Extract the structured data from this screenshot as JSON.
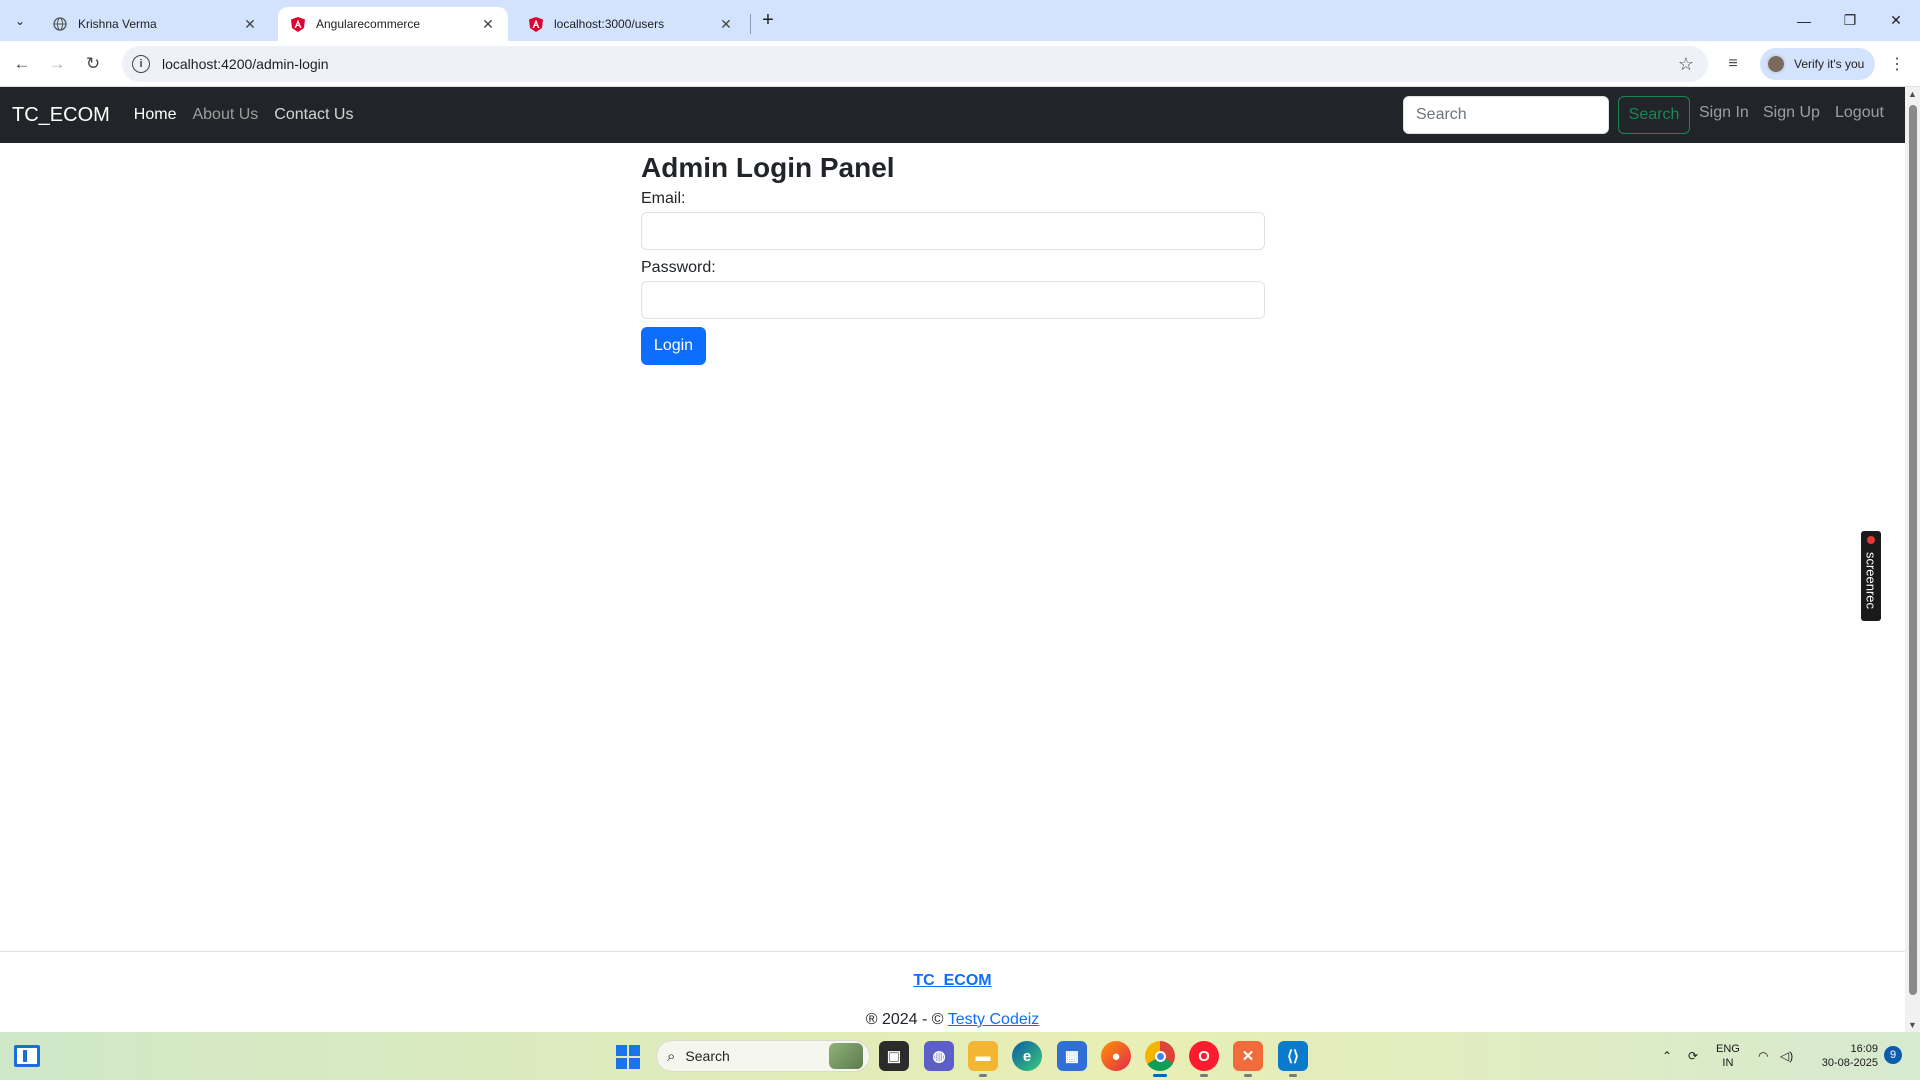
{
  "browser": {
    "tabs": [
      {
        "title": "Krishna Verma",
        "icon": "globe-icon"
      },
      {
        "title": "Angularecommerce",
        "icon": "angular-icon"
      },
      {
        "title": "localhost:3000/users",
        "icon": "angular-icon"
      }
    ],
    "url": "localhost:4200/admin-login",
    "profile_label": "Verify it's you"
  },
  "navbar": {
    "brand": "TC_ECOM",
    "links": [
      "Home",
      "About Us",
      "Contact Us"
    ],
    "search_placeholder": "Search",
    "search_button": "Search",
    "right_links": [
      "Sign In",
      "Sign Up",
      "Logout"
    ]
  },
  "login": {
    "title": "Admin Login Panel",
    "email_label": "Email:",
    "password_label": "Password:",
    "submit": "Login"
  },
  "footer": {
    "brand": "TC_ECOM",
    "copy_prefix": "® 2024 - ©",
    "copy_link": "Testy Codeiz"
  },
  "overlay": {
    "screenrec_label": "screenrec"
  },
  "taskbar": {
    "search_label": "Search",
    "lang_line1": "ENG",
    "lang_line2": "IN",
    "time": "16:09",
    "date": "30-08-2025",
    "notification_count": "9"
  },
  "colors": {
    "navbar_bg": "#212529",
    "primary": "#0d6efd",
    "success": "#198754"
  }
}
